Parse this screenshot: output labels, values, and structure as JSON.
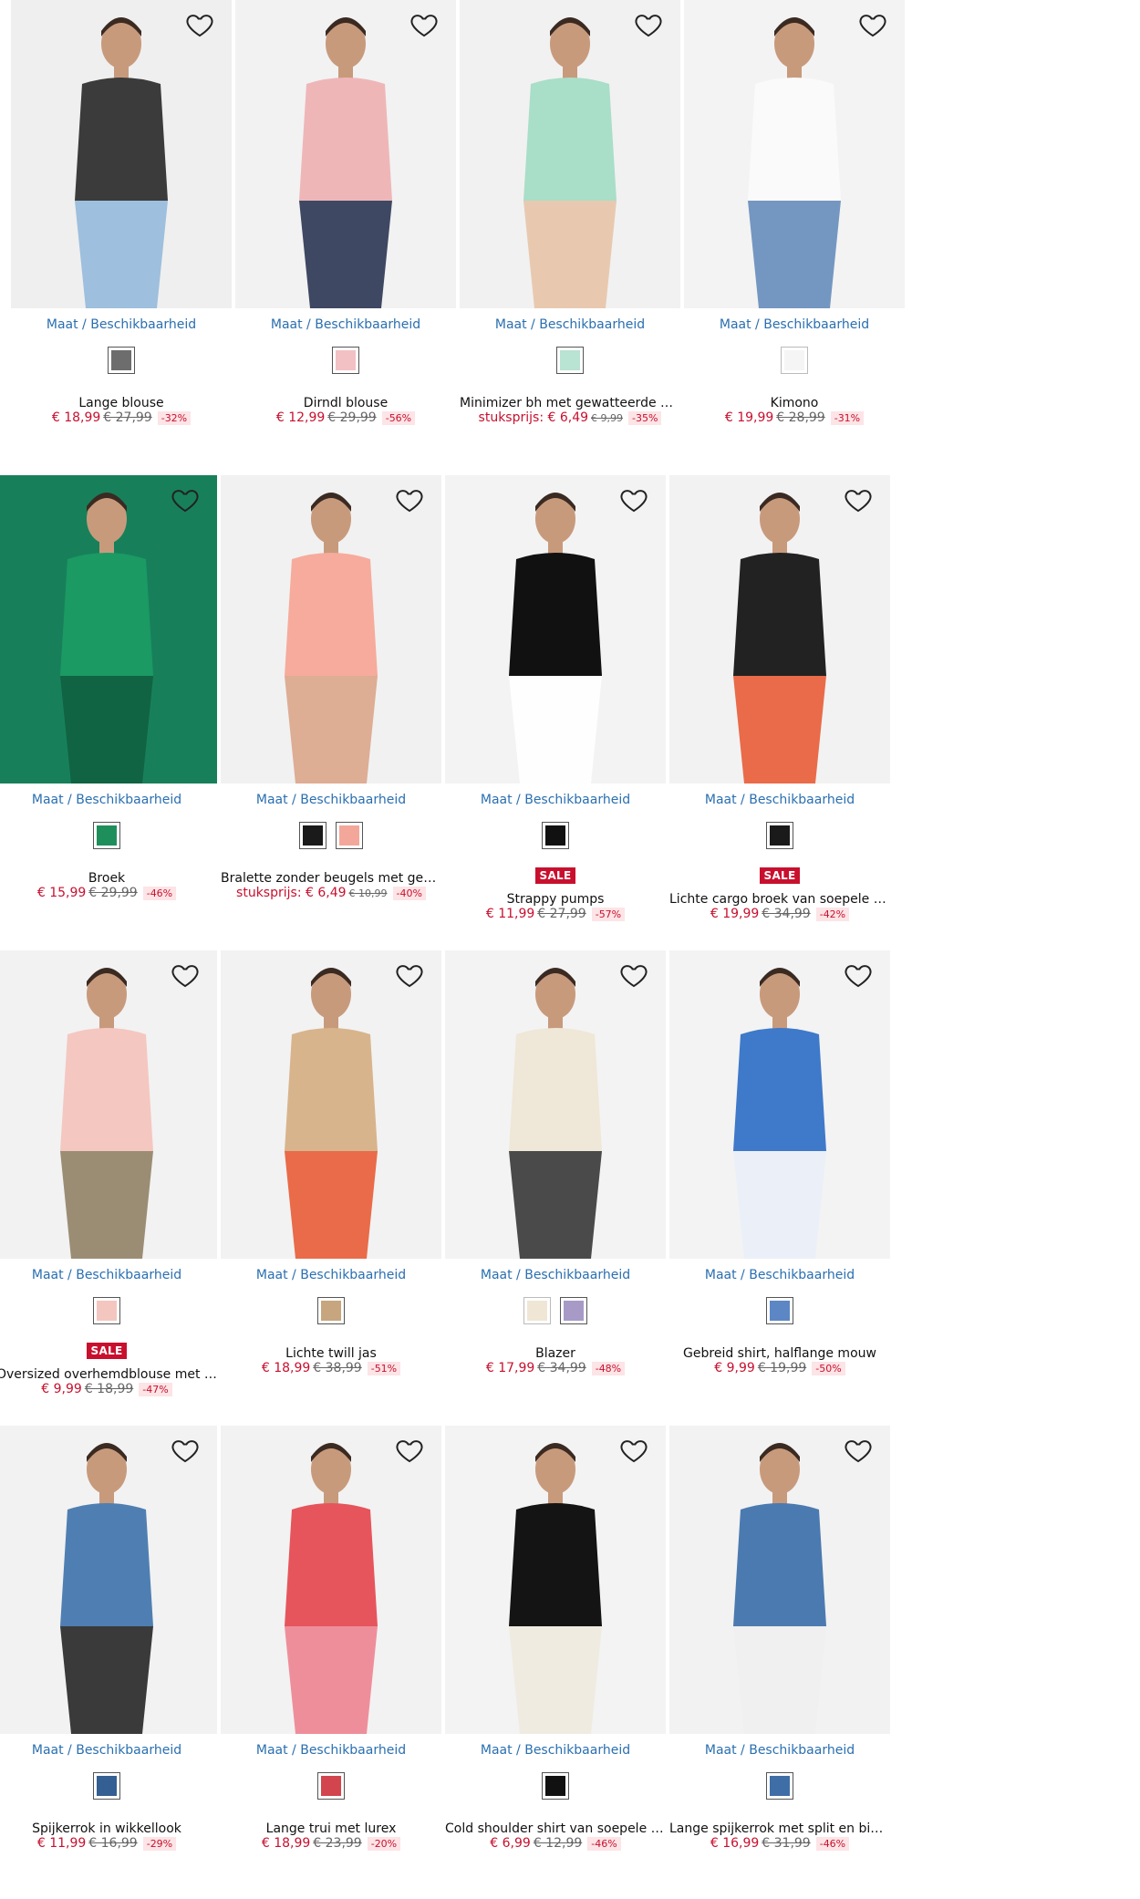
{
  "common": {
    "size_link": "Maat / Beschikbaarheid",
    "sale_badge": "SALE"
  },
  "products": [
    {
      "name": "Lange blouse",
      "price": "€ 18,99",
      "old_price": "€ 27,99",
      "discount": "-32%",
      "sale": false,
      "swatches": [
        "#6d6d6d"
      ],
      "bg": "#efefef",
      "garment": "#3b3b3b",
      "accent": "#8fb6d9"
    },
    {
      "name": "Dirndl blouse",
      "price": "€ 12,99",
      "old_price": "€ 29,99",
      "discount": "-56%",
      "sale": false,
      "swatches": [
        "#f2c1c4"
      ],
      "bg": "#f2f2f2",
      "garment": "#efb6b8",
      "accent": "#1e2a4a"
    },
    {
      "name": "Minimizer bh met gewatteerde ban...",
      "price": "stuksprijs: € 6,49",
      "old_price": "€ 9,99",
      "discount": "-35%",
      "sale": false,
      "swatches": [
        "#b9e3d2"
      ],
      "bg": "#f1f1f1",
      "garment": "#a9dec8",
      "accent": "#e6c2a5"
    },
    {
      "name": "Kimono",
      "price": "€ 19,99",
      "old_price": "€ 28,99",
      "discount": "-31%",
      "sale": false,
      "swatches": [
        "#f5f5f5"
      ],
      "bg": "#f3f3f3",
      "garment": "#fafafa",
      "accent": "#5d86b7"
    },
    {
      "name": "Broek",
      "price": "€ 15,99",
      "old_price": "€ 29,99",
      "discount": "-46%",
      "sale": false,
      "swatches": [
        "#1e8f5a"
      ],
      "bg": "#17805a",
      "garment": "#1b9a63",
      "accent": "#0f5e40"
    },
    {
      "name": "Bralette zonder beugels met gevul...",
      "price": "stuksprijs: € 6,49",
      "old_price": "€ 10,99",
      "discount": "-40%",
      "sale": false,
      "swatches": [
        "#1a1a1a",
        "#f3a79a"
      ],
      "bg": "#f1f1f1",
      "garment": "#f6ab9c",
      "accent": "#d9a184"
    },
    {
      "name": "Strappy pumps",
      "price": "€ 11,99",
      "old_price": "€ 27,99",
      "discount": "-57%",
      "sale": true,
      "swatches": [
        "#111111"
      ],
      "bg": "#f3f3f3",
      "garment": "#111111",
      "accent": "#ffffff"
    },
    {
      "name": "Lichte cargo broek van soepele Lyo...",
      "price": "€ 19,99",
      "old_price": "€ 34,99",
      "discount": "-42%",
      "sale": true,
      "swatches": [
        "#1a1a1a"
      ],
      "bg": "#f2f2f2",
      "garment": "#222222",
      "accent": "#e8542c"
    },
    {
      "name": "Oversized overhemdblouse met kn...",
      "price": "€ 9,99",
      "old_price": "€ 18,99",
      "discount": "-47%",
      "sale": true,
      "swatches": [
        "#f4c6c0"
      ],
      "bg": "#f2f2f2",
      "garment": "#f5c7c1",
      "accent": "#8c7b5e"
    },
    {
      "name": "Lichte twill jas",
      "price": "€ 18,99",
      "old_price": "€ 38,99",
      "discount": "-51%",
      "sale": false,
      "swatches": [
        "#c7a57e"
      ],
      "bg": "#f2f2f2",
      "garment": "#d8b48c",
      "accent": "#e8542c"
    },
    {
      "name": "Blazer",
      "price": "€ 17,99",
      "old_price": "€ 34,99",
      "discount": "-48%",
      "sale": false,
      "swatches": [
        "#efe6d6",
        "#a79ac7"
      ],
      "bg": "#f3f3f3",
      "garment": "#efe7d7",
      "accent": "#2b2b2b"
    },
    {
      "name": "Gebreid shirt, halflange mouw",
      "price": "€ 9,99",
      "old_price": "€ 19,99",
      "discount": "-50%",
      "sale": false,
      "swatches": [
        "#5c87c4"
      ],
      "bg": "#f3f3f3",
      "garment": "#3f79c9",
      "accent": "#e9eef8"
    },
    {
      "name": "Spijkerrok in wikkellook",
      "price": "€ 11,99",
      "old_price": "€ 16,99",
      "discount": "-29%",
      "sale": false,
      "swatches": [
        "#335f92"
      ],
      "bg": "#f2f2f2",
      "garment": "#4f7fb2",
      "accent": "#1a1a1a"
    },
    {
      "name": "Lange trui met lurex",
      "price": "€ 18,99",
      "old_price": "€ 23,99",
      "discount": "-20%",
      "sale": false,
      "swatches": [
        "#d2444e"
      ],
      "bg": "#f2f2f2",
      "garment": "#e6555c",
      "accent": "#ef7d8c"
    },
    {
      "name": "Cold shoulder shirt van soepele visc...",
      "price": "€ 6,99",
      "old_price": "€ 12,99",
      "discount": "-46%",
      "sale": false,
      "swatches": [
        "#111111"
      ],
      "bg": "#f3f3f3",
      "garment": "#141414",
      "accent": "#efe9dc"
    },
    {
      "name": "Lange spijkerrok met split en biolo...",
      "price": "€ 16,99",
      "old_price": "€ 31,99",
      "discount": "-46%",
      "sale": false,
      "swatches": [
        "#3f6ea6"
      ],
      "bg": "#f2f2f2",
      "garment": "#4b7ab0",
      "accent": "#f0f0f0"
    }
  ]
}
